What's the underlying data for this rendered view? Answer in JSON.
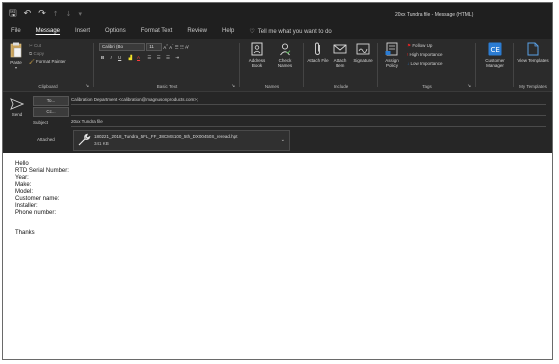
{
  "window": {
    "title": "20xx Tundra file - Message (HTML)"
  },
  "quick_access": {
    "save_icon": "save-icon",
    "undo_icon": "undo-icon",
    "redo_icon": "redo-icon",
    "up_icon": "arrow-up-icon",
    "down_icon": "arrow-down-icon",
    "customize": "▾"
  },
  "menu": {
    "tabs": [
      "File",
      "Message",
      "Insert",
      "Options",
      "Format Text",
      "Review",
      "Help"
    ],
    "active": "Message",
    "tell_me": "Tell me what you want to do"
  },
  "ribbon": {
    "clipboard": {
      "label": "Clipboard",
      "paste": "Paste",
      "cut": "Cut",
      "copy": "Copy",
      "format_painter": "Format Painter"
    },
    "basic_text": {
      "label": "Basic Text",
      "font": "Calibri (Bo",
      "size": "11",
      "bold": "B",
      "italic": "I",
      "underline": "U",
      "font_color": "A"
    },
    "names": {
      "label": "Names",
      "address_book": "Address Book",
      "check_names": "Check Names"
    },
    "include": {
      "label": "Include",
      "attach_file": "Attach File",
      "attach_item": "Attach Item",
      "signature": "Signature"
    },
    "tags": {
      "label": "Tags",
      "assign_policy": "Assign Policy",
      "follow_up": "Follow Up",
      "high_importance": "High Importance",
      "low_importance": "Low Importance"
    },
    "customer_manager": {
      "label": "Customer Manager"
    },
    "my_templates": {
      "label": "My Templates",
      "view_templates": "View Templates"
    }
  },
  "compose": {
    "send": "Send",
    "to_button": "To...",
    "cc_button": "Cc...",
    "to_value": "Calibration Department <calibration@magnusonproducts.com>;",
    "cc_value": "",
    "subject_label": "Subject",
    "subject_value": "20xx Tundra file",
    "attached_label": "Attached",
    "attachment": {
      "name": "180221_2018_Tundra_5FL_FF_38CMS100_5th_DX00450S_reread.hpt",
      "size": "341 KB"
    }
  },
  "body": {
    "lines": [
      "Hello",
      "RTD Serial Number:",
      "Year:",
      "Make:",
      "Model:",
      "Customer name:",
      "Installer:",
      "Phone number:",
      "",
      "Thanks"
    ]
  },
  "colors": {
    "titlebar": "#1f1f1f",
    "ribbon": "#2b2b2b",
    "compose": "#262626",
    "accent_blue": "#2b7cd3",
    "flag_red": "#e02424"
  }
}
